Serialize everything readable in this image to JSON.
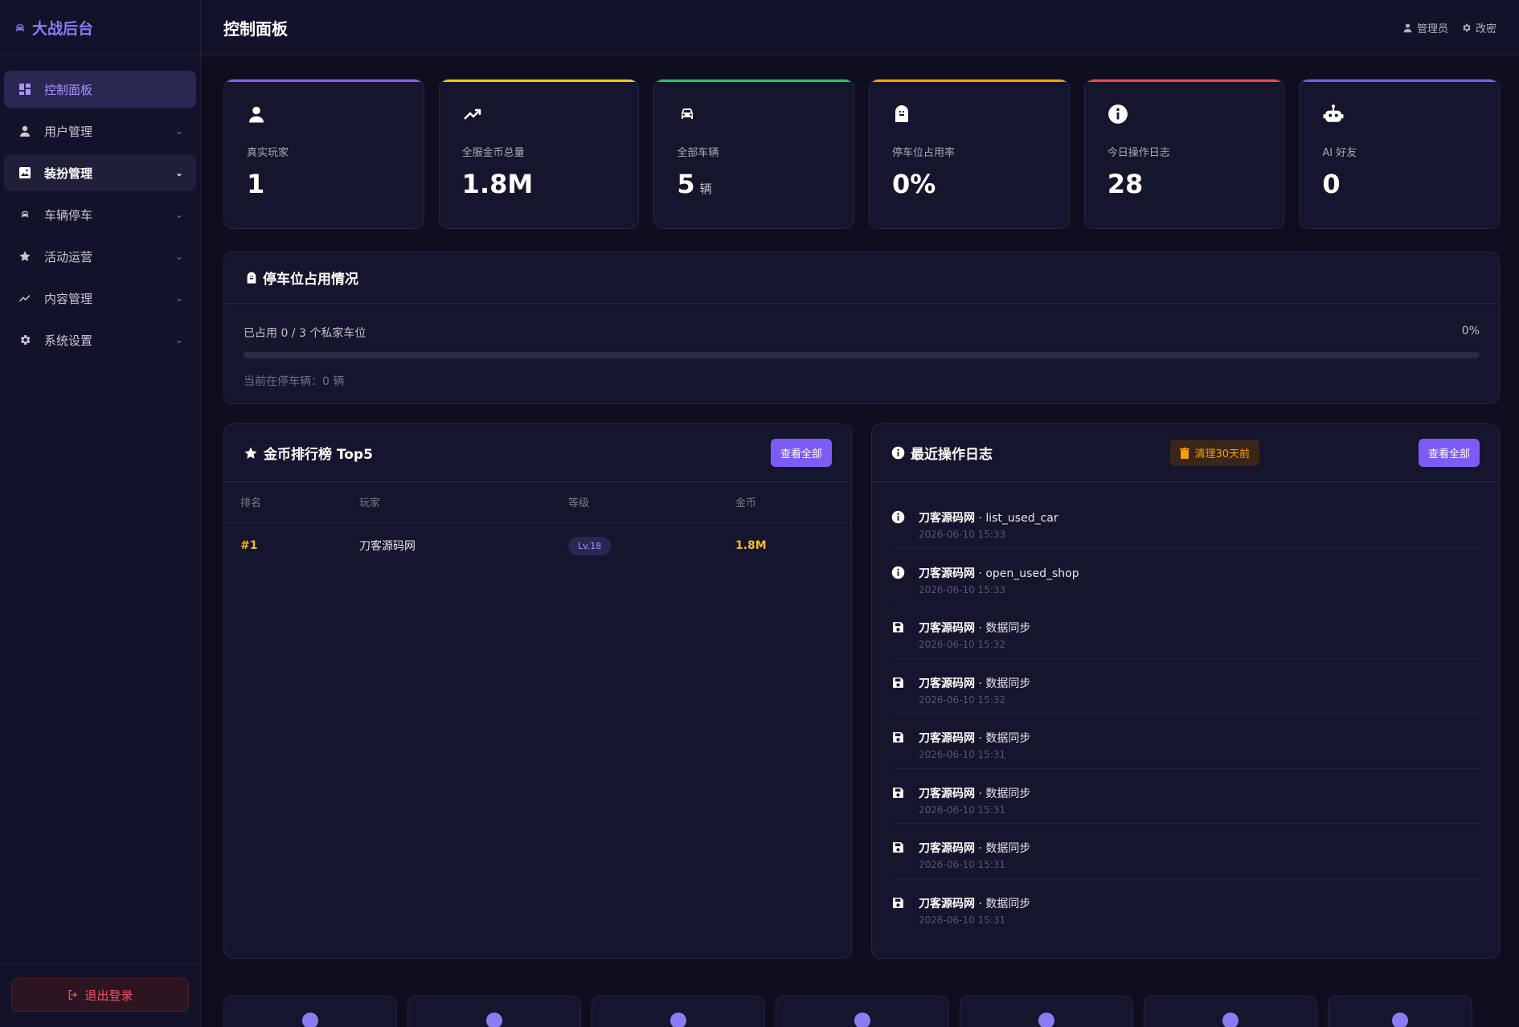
{
  "brand": {
    "title": "大战后台"
  },
  "sidebar": {
    "items": [
      {
        "label": "控制面板",
        "icon": "dashboard-icon"
      },
      {
        "label": "用户管理",
        "icon": "user-icon"
      },
      {
        "label": "装扮管理",
        "icon": "image-icon"
      },
      {
        "label": "车辆停车",
        "icon": "car-icon"
      },
      {
        "label": "活动运营",
        "icon": "star-icon"
      },
      {
        "label": "内容管理",
        "icon": "trend-icon"
      },
      {
        "label": "系统设置",
        "icon": "gear-icon"
      }
    ],
    "logout": "退出登录"
  },
  "topbar": {
    "title": "控制面板",
    "user": "管理员",
    "settings": "改密"
  },
  "stats": [
    {
      "label": "真实玩家",
      "value": "1",
      "unit": "",
      "icon": "user-icon",
      "color": "#8b5cf6"
    },
    {
      "label": "全服金币总量",
      "value": "1.8M",
      "unit": "",
      "icon": "trending-up-icon",
      "color": "#f5c518"
    },
    {
      "label": "全部车辆",
      "value": "5",
      "unit": "辆",
      "icon": "car-icon",
      "color": "#22c55e"
    },
    {
      "label": "停车位占用率",
      "value": "0%",
      "unit": "",
      "icon": "parking-icon",
      "color": "#f59e0b"
    },
    {
      "label": "今日操作日志",
      "value": "28",
      "unit": "",
      "icon": "info-icon",
      "color": "#ef4444"
    },
    {
      "label": "AI 好友",
      "value": "0",
      "unit": "",
      "icon": "robot-icon",
      "color": "#6366f1"
    }
  ],
  "parking": {
    "title": "停车位占用情况",
    "occupied_text": "已占用 0 / 3 个私家车位",
    "percent_text": "0%",
    "fill_fraction": 0,
    "current_text": "当前在停车辆：0 辆"
  },
  "leaderboard": {
    "title": "金币排行榜 Top5",
    "view_all": "查看全部",
    "columns": [
      "排名",
      "玩家",
      "等级",
      "金币"
    ],
    "rows": [
      {
        "rank": "#1",
        "player": "刀客源码网",
        "level": "Lv.18",
        "coins": "1.8M"
      }
    ]
  },
  "logs": {
    "title": "最近操作日志",
    "clear_label": "清理30天前",
    "view_all": "查看全部",
    "items": [
      {
        "icon": "info-icon",
        "user": "刀客源码网",
        "action": " · list_used_car",
        "time": "2026-06-10 15:33"
      },
      {
        "icon": "info-icon",
        "user": "刀客源码网",
        "action": " · open_used_shop",
        "time": "2026-06-10 15:33"
      },
      {
        "icon": "save-icon",
        "user": "刀客源码网",
        "action": " · 数据同步",
        "time": "2026-06-10 15:32"
      },
      {
        "icon": "save-icon",
        "user": "刀客源码网",
        "action": " · 数据同步",
        "time": "2026-06-10 15:32"
      },
      {
        "icon": "save-icon",
        "user": "刀客源码网",
        "action": " · 数据同步",
        "time": "2026-06-10 15:31"
      },
      {
        "icon": "save-icon",
        "user": "刀客源码网",
        "action": " · 数据同步",
        "time": "2026-06-10 15:31"
      },
      {
        "icon": "save-icon",
        "user": "刀客源码网",
        "action": " · 数据同步",
        "time": "2026-06-10 15:31"
      },
      {
        "icon": "save-icon",
        "user": "刀客源码网",
        "action": " · 数据同步",
        "time": "2026-06-10 15:31"
      }
    ]
  }
}
